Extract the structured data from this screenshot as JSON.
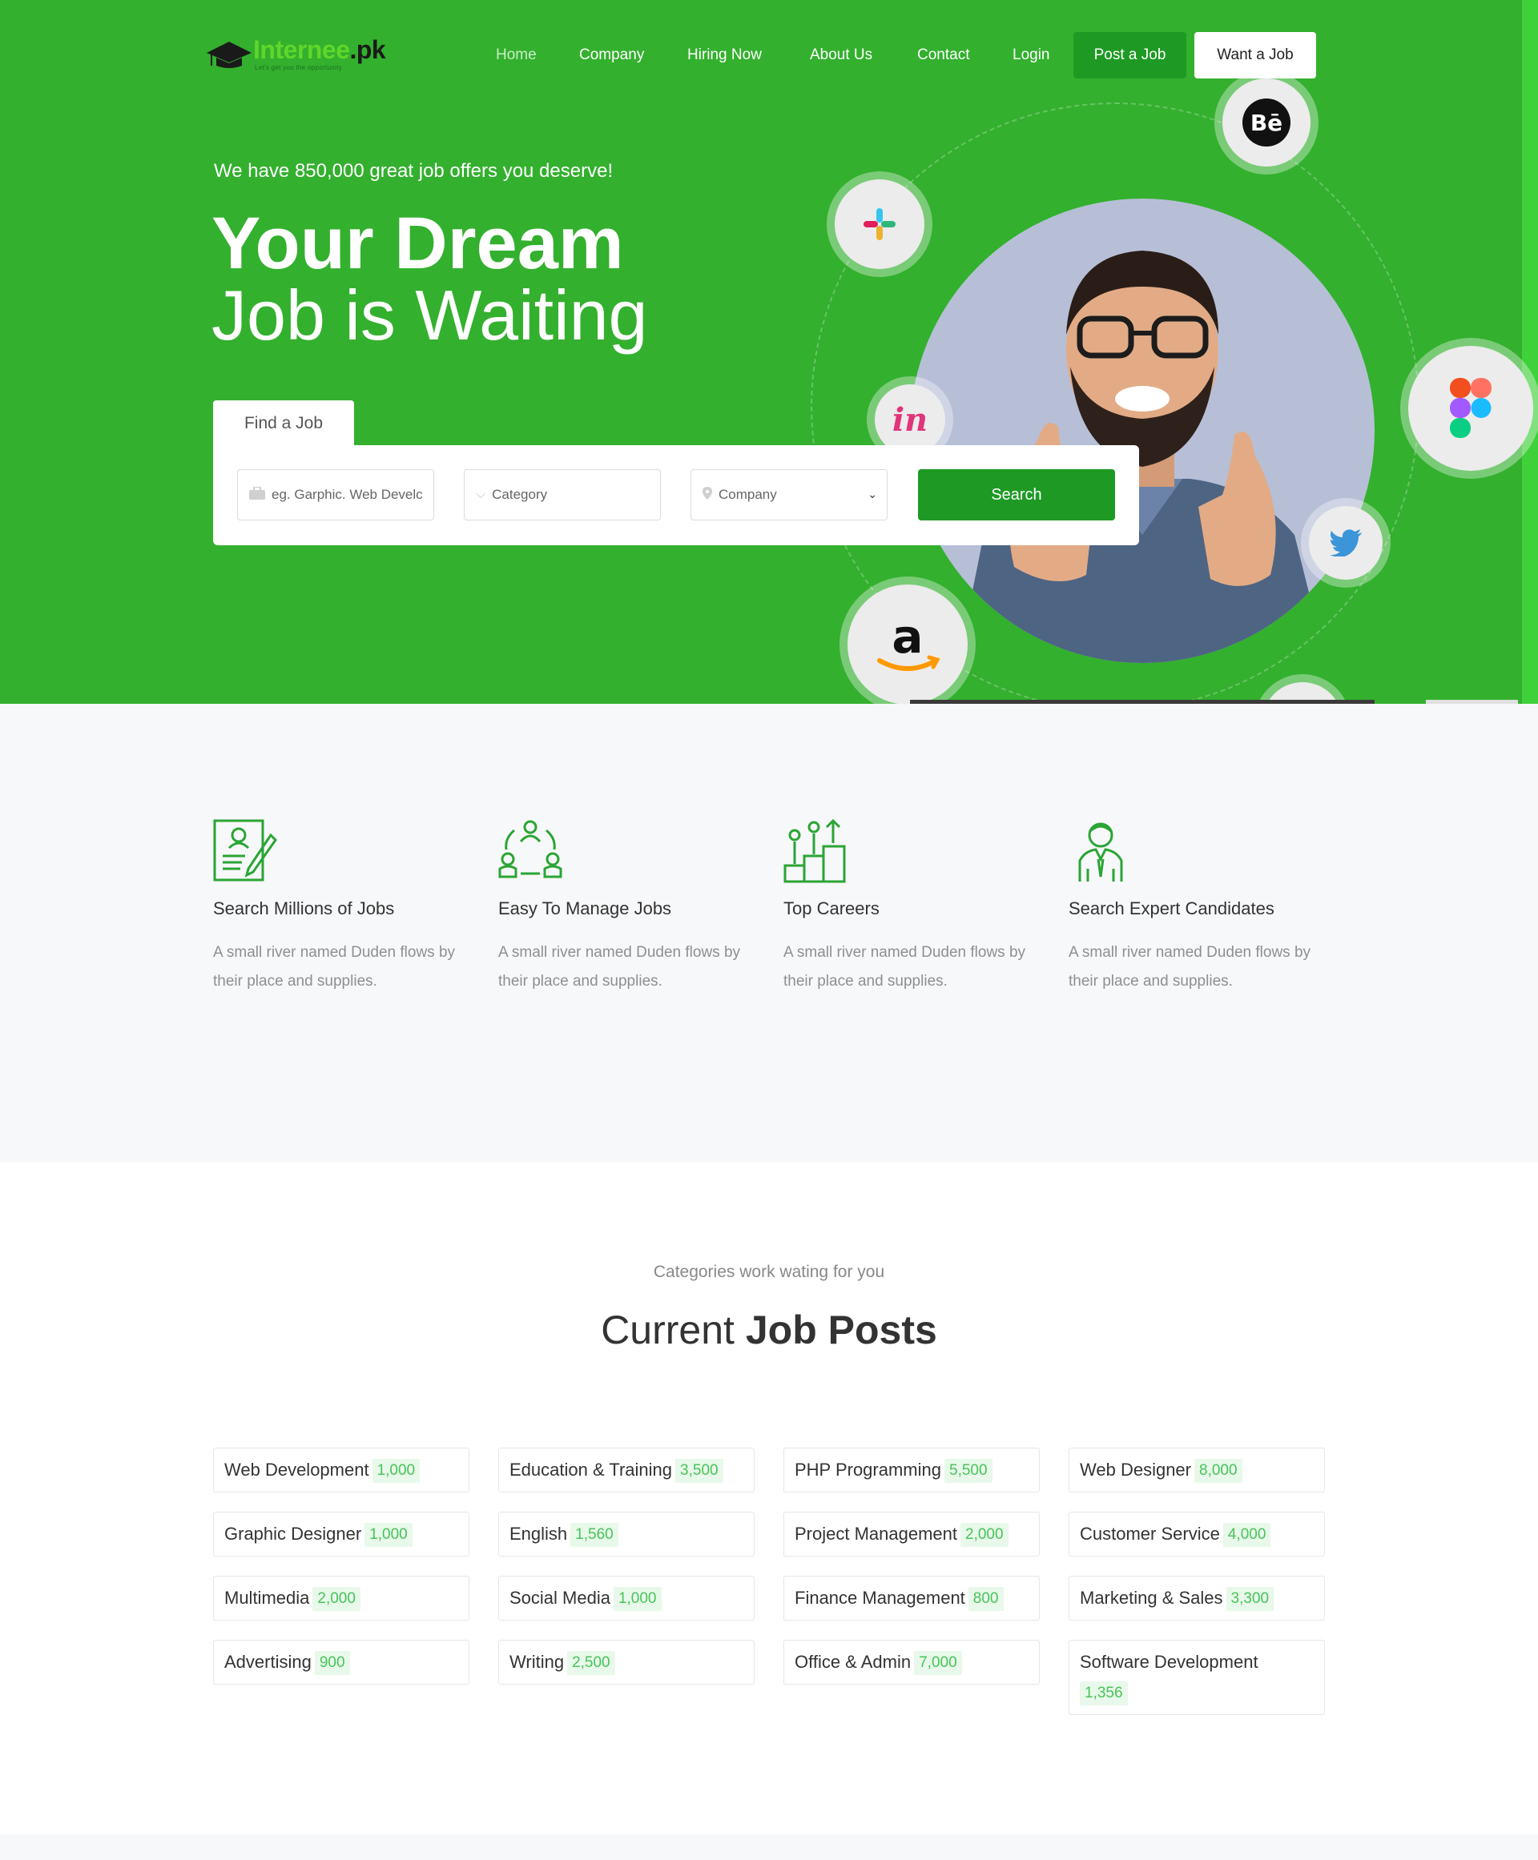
{
  "brand": {
    "name_part1": "Internee",
    "name_part2": ".pk",
    "tagline": "Let's get you the opportunity"
  },
  "nav": {
    "items": [
      "Home",
      "Company",
      "Hiring Now",
      "About Us",
      "Contact",
      "Login"
    ],
    "post_job": "Post a Job",
    "want_job": "Want a Job"
  },
  "hero": {
    "subtitle": "We have 850,000 great job offers you deserve!",
    "title_line1": "Your Dream",
    "title_line2": "Job is Waiting"
  },
  "search": {
    "tab_label": "Find a Job",
    "keyword_placeholder": "eg. Garphic. Web Develc",
    "category_value": "Category",
    "company_value": "Company",
    "search_button": "Search"
  },
  "brand_bubbles": [
    "behance-icon",
    "slack-icon",
    "invision-icon",
    "figma-icon",
    "twitter-icon",
    "amazon-icon"
  ],
  "features": [
    {
      "icon": "resume-icon",
      "title": "Search Millions of Jobs",
      "desc": "A small river named Duden flows by their place and supplies."
    },
    {
      "icon": "team-cycle-icon",
      "title": "Easy To Manage Jobs",
      "desc": "A small river named Duden flows by their place and supplies."
    },
    {
      "icon": "career-growth-icon",
      "title": "Top Careers",
      "desc": "A small river named Duden flows by their place and supplies."
    },
    {
      "icon": "candidate-icon",
      "title": "Search Expert Candidates",
      "desc": "A small river named Duden flows by their place and supplies."
    }
  ],
  "categories": {
    "subtitle": "Categories work wating for you",
    "heading_light": "Current",
    "heading_bold": "Job Posts",
    "items": [
      {
        "name": "Web Development",
        "count": "1,000"
      },
      {
        "name": "Education & Training",
        "count": "3,500"
      },
      {
        "name": "PHP Programming",
        "count": "5,500"
      },
      {
        "name": "Web Designer",
        "count": "8,000"
      },
      {
        "name": "Graphic Designer",
        "count": "1,000"
      },
      {
        "name": "English",
        "count": "1,560"
      },
      {
        "name": "Project Management",
        "count": "2,000"
      },
      {
        "name": "Customer Service",
        "count": "4,000"
      },
      {
        "name": "Multimedia",
        "count": "2,000"
      },
      {
        "name": "Social Media",
        "count": "1,000"
      },
      {
        "name": "Finance Management",
        "count": "800"
      },
      {
        "name": "Marketing & Sales",
        "count": "3,300"
      },
      {
        "name": "Advertising",
        "count": "900"
      },
      {
        "name": "Writing",
        "count": "2,500"
      },
      {
        "name": "Office & Admin",
        "count": "7,000"
      },
      {
        "name": "Software Development",
        "count": "1,356"
      }
    ]
  },
  "colors": {
    "hero_green": "#33b02e",
    "button_green": "#1e9a24",
    "count_text": "#48c45a",
    "count_bg": "#e8f8ea"
  }
}
